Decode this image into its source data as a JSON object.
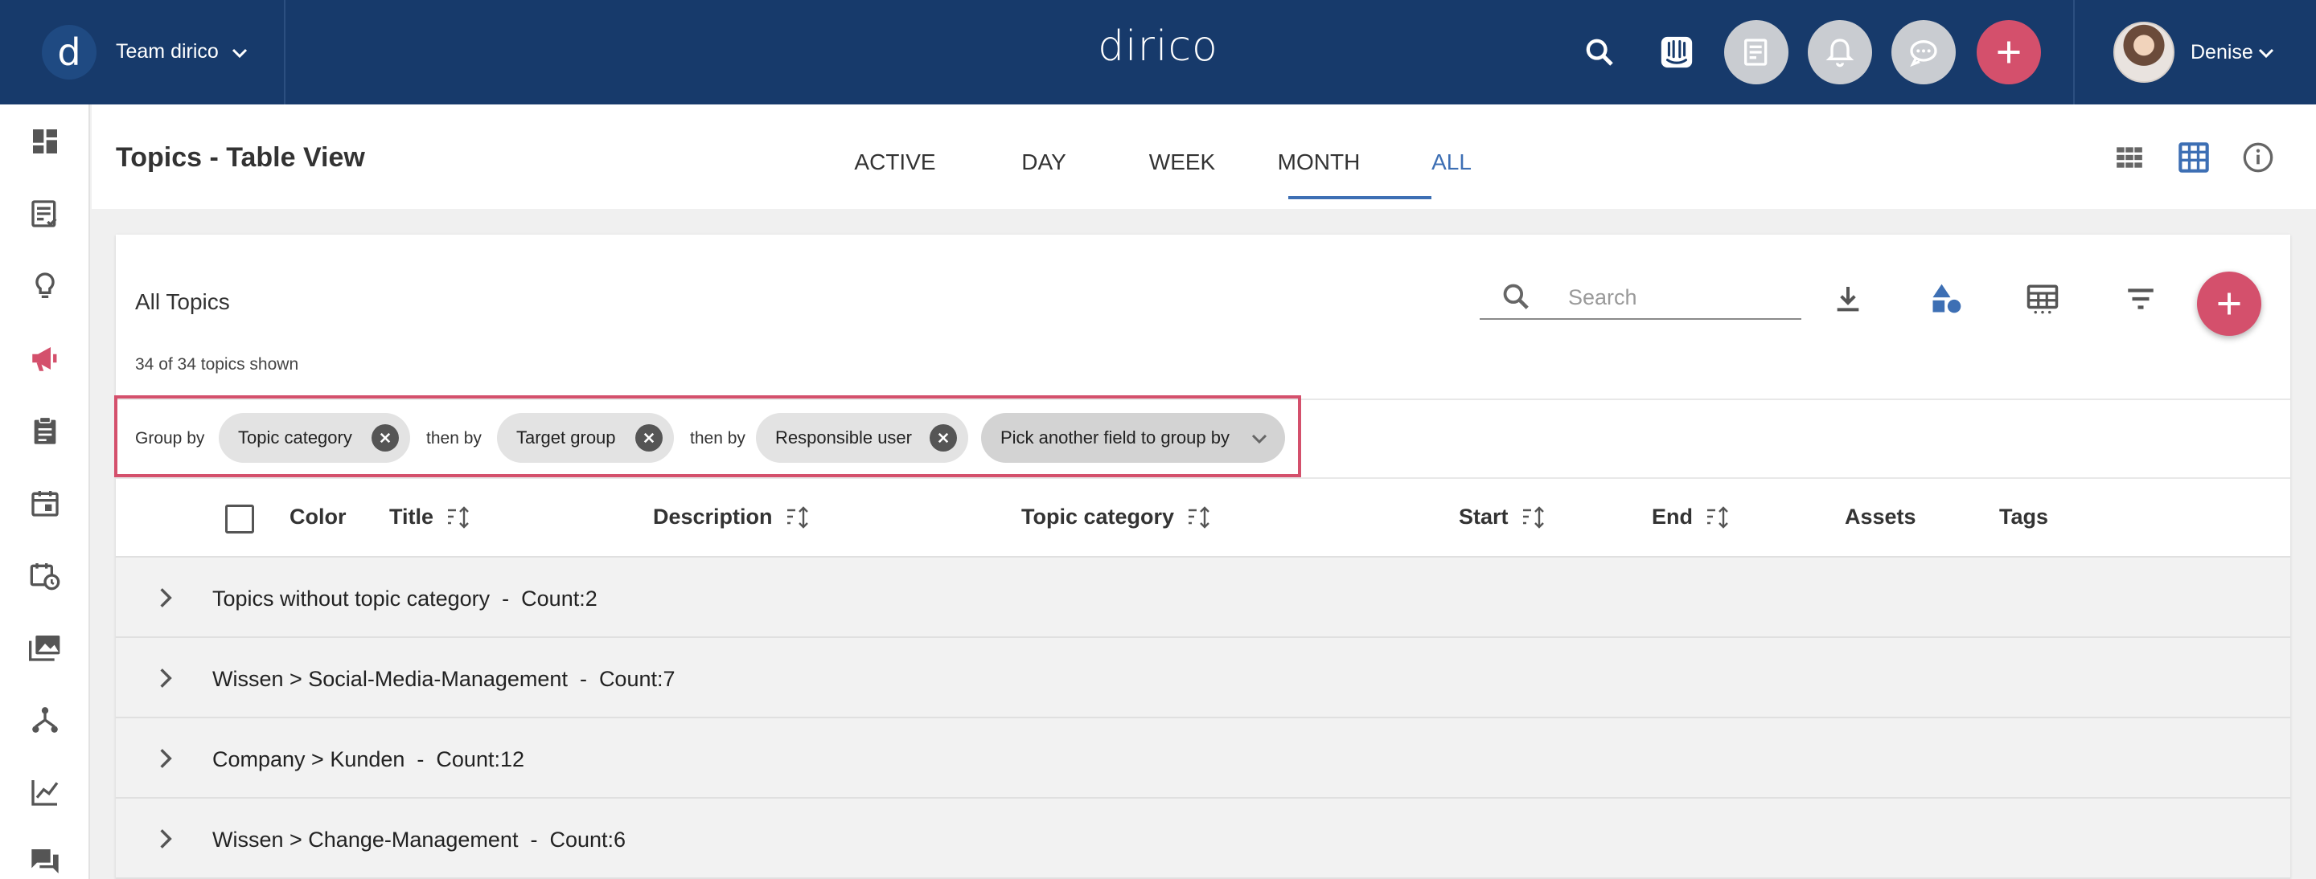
{
  "topbar": {
    "team_name": "Team dirico",
    "brand": "dirico",
    "user_name": "Denise",
    "logo_letter": "d",
    "colors": {
      "bar": "#173a6b",
      "accent": "#d4506c"
    },
    "icons": [
      "search-icon",
      "intercom-icon",
      "tasks-icon",
      "bell-icon",
      "chat-icon",
      "add-icon"
    ]
  },
  "sidebar": {
    "icons": [
      "dashboard-icon",
      "checklist-icon",
      "lightbulb-icon",
      "megaphone-icon",
      "clipboard-icon",
      "calendar-icon",
      "calendar-clock-icon",
      "media-library-icon",
      "hierarchy-icon",
      "analytics-icon",
      "comments-icon"
    ],
    "active": "megaphone-icon"
  },
  "header": {
    "title": "Topics - Table View",
    "tabs": [
      {
        "label": "ACTIVE"
      },
      {
        "label": "DAY"
      },
      {
        "label": "WEEK"
      },
      {
        "label": "MONTH"
      },
      {
        "label": "ALL"
      }
    ],
    "active_tab": "ALL"
  },
  "card": {
    "title": "All Topics",
    "count_text": "34 of 34 topics shown",
    "search_placeholder": "Search"
  },
  "groupby": {
    "label": "Group by",
    "then_label": "then by",
    "chips": [
      {
        "label": "Topic category"
      },
      {
        "label": "Target group"
      },
      {
        "label": "Responsible user"
      }
    ],
    "picker_label": "Pick another field to group by"
  },
  "table": {
    "headers": {
      "color": "Color",
      "title": "Title",
      "description": "Description",
      "topic_category": "Topic category",
      "start": "Start",
      "end": "End",
      "assets": "Assets",
      "tags": "Tags"
    },
    "groups": [
      {
        "label": "Topics without topic category  -  Count:2"
      },
      {
        "label": "Wissen > Social-Media-Management  -  Count:7"
      },
      {
        "label": "Company > Kunden  -  Count:12"
      },
      {
        "label": "Wissen > Change-Management  -  Count:6"
      }
    ]
  }
}
